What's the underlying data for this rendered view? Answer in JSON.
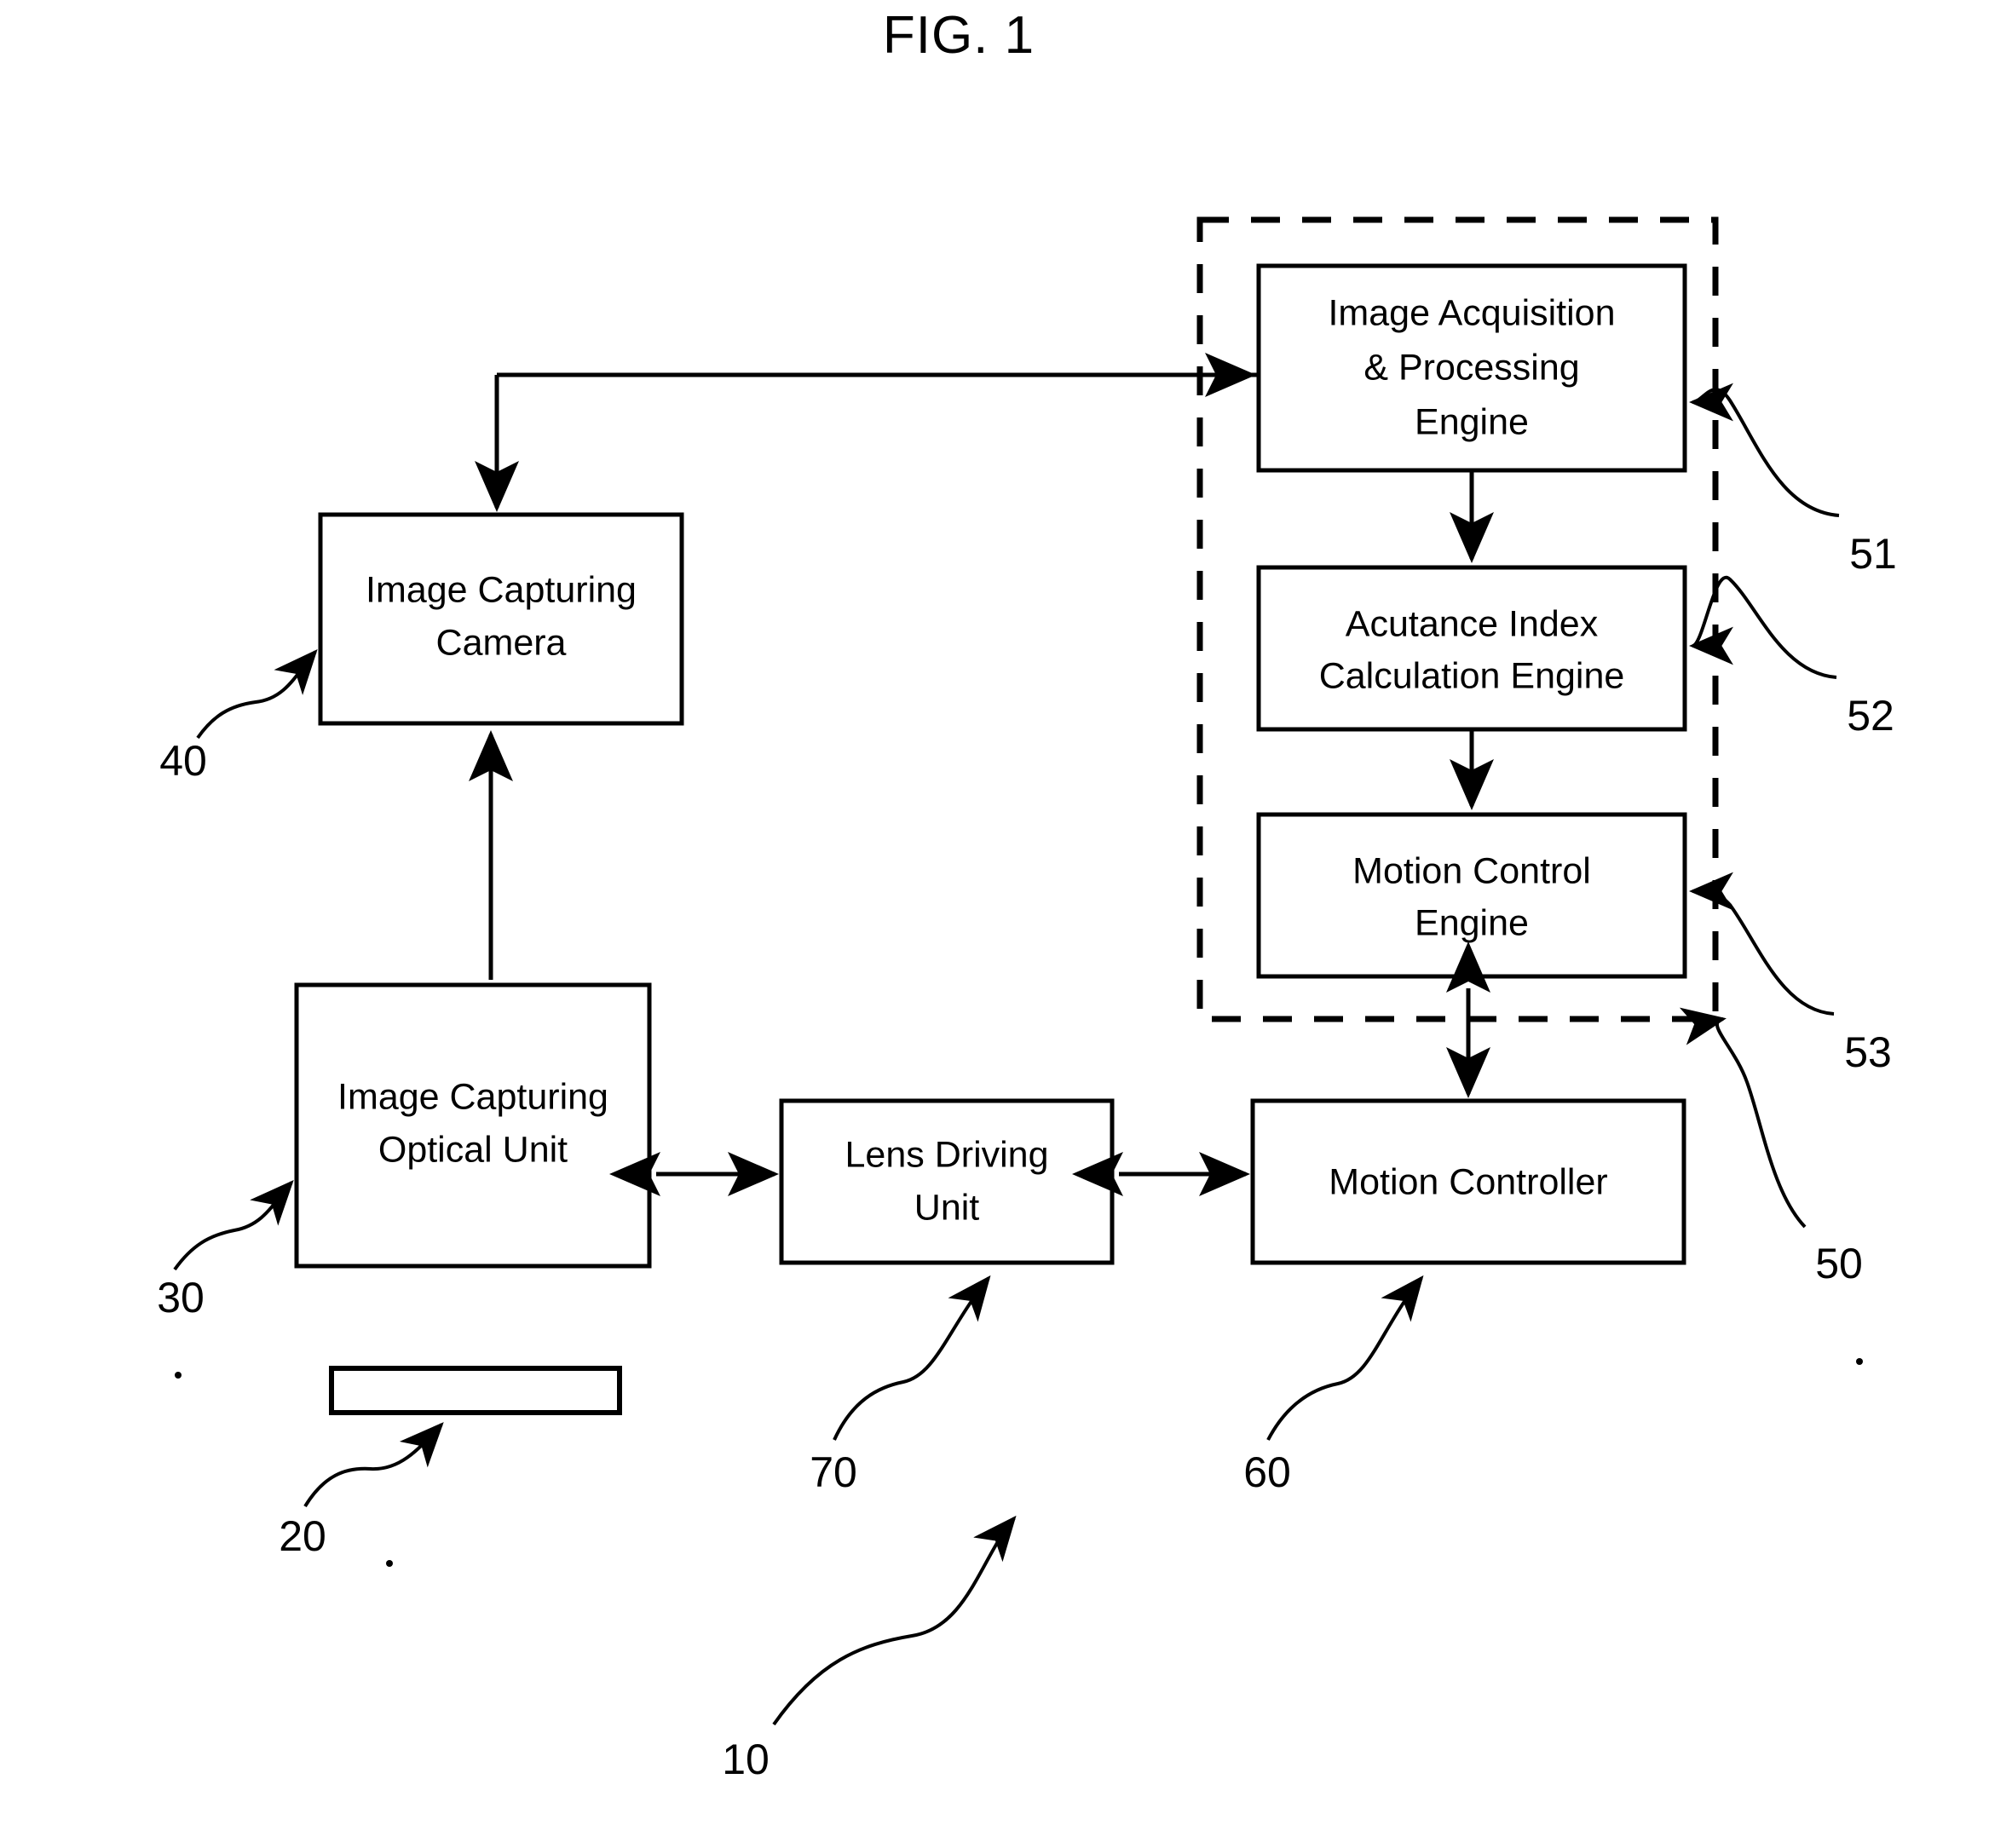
{
  "figure": {
    "title": "FIG. 1"
  },
  "boxes": {
    "image_acquisition": {
      "lines": [
        "Image Acquisition",
        "& Processing",
        "Engine"
      ],
      "ref": "51"
    },
    "acutance_index": {
      "lines": [
        "Acutance Index",
        "Calculation Engine"
      ],
      "ref": "52"
    },
    "motion_control_engine": {
      "lines": [
        "Motion Control",
        "Engine"
      ],
      "ref": "53"
    },
    "image_capturing_camera": {
      "lines": [
        "Image Capturing",
        "Camera"
      ],
      "ref": "40"
    },
    "image_capturing_optical_unit": {
      "lines": [
        "Image Capturing",
        "Optical Unit"
      ],
      "ref": "30"
    },
    "lens_driving_unit": {
      "lines": [
        "Lens Driving",
        "Unit"
      ],
      "ref": "70"
    },
    "motion_controller": {
      "lines": [
        "Motion Controller"
      ],
      "ref": "60"
    },
    "target_object": {
      "lines": [],
      "ref": "20"
    }
  },
  "groups": {
    "dashed_enclosure": {
      "ref": "50"
    }
  },
  "system": {
    "ref": "10"
  },
  "reference_numerals": [
    {
      "id": "10",
      "label": "10",
      "points_to": "overall-system"
    },
    {
      "id": "20",
      "label": "20",
      "points_to": "target-object"
    },
    {
      "id": "30",
      "label": "30",
      "points_to": "image-capturing-optical-unit"
    },
    {
      "id": "40",
      "label": "40",
      "points_to": "image-capturing-camera"
    },
    {
      "id": "50",
      "label": "50",
      "points_to": "dashed-enclosure"
    },
    {
      "id": "51",
      "label": "51",
      "points_to": "image-acquisition-processing-engine"
    },
    {
      "id": "52",
      "label": "52",
      "points_to": "acutance-index-calculation-engine"
    },
    {
      "id": "53",
      "label": "53",
      "points_to": "motion-control-engine"
    },
    {
      "id": "60",
      "label": "60",
      "points_to": "motion-controller"
    },
    {
      "id": "70",
      "label": "70",
      "points_to": "lens-driving-unit"
    }
  ],
  "colors": {
    "ink": "#000000",
    "paper": "#ffffff"
  }
}
